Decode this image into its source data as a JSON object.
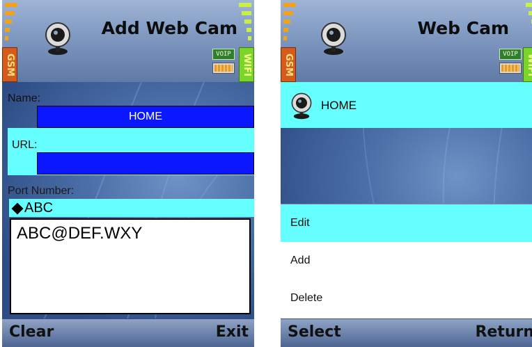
{
  "left": {
    "title": "Add Web Cam",
    "status": {
      "gsm": "GSM",
      "wifi": "WIFI",
      "voip": "VOIP"
    },
    "fields": {
      "name_label": "Name:",
      "name_value": "HOME",
      "url_label": "URL:",
      "url_value": "",
      "port_label": "Port Number:"
    },
    "input_mode": "ABC",
    "edit_text": "ABC@DEF.WXY",
    "softkeys": {
      "left": "Clear",
      "right": "Exit"
    }
  },
  "right": {
    "title": "Web Cam",
    "status": {
      "gsm": "GSM",
      "wifi": "WIFI",
      "voip": "VOIP"
    },
    "list": [
      {
        "label": "HOME",
        "icon": "webcam-icon"
      }
    ],
    "menu": [
      {
        "label": "Edit",
        "selected": true
      },
      {
        "label": "Add"
      },
      {
        "label": "Delete"
      }
    ],
    "softkeys": {
      "left": "Select",
      "right": "Return"
    }
  },
  "colors": {
    "highlight": "#66ffff",
    "field_blue": "#0a17ff",
    "gsm": "#d45a1e",
    "wifi": "#7ad42a"
  }
}
